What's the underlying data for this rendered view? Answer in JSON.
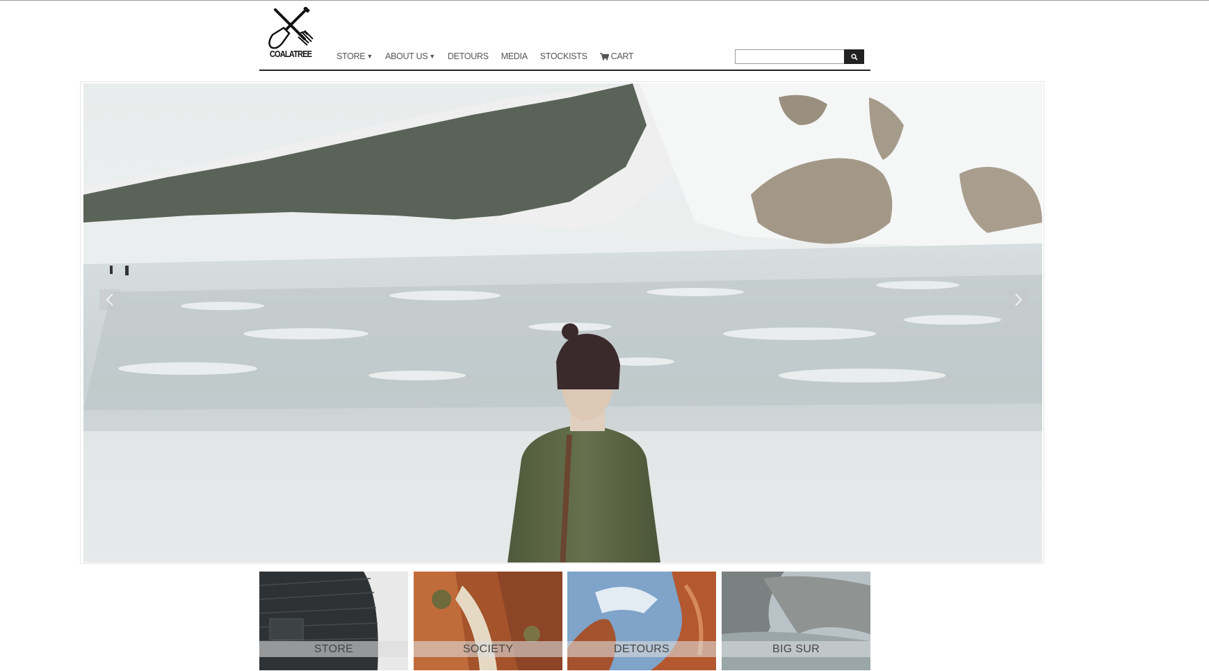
{
  "brand": {
    "logo_text": "COALATREE",
    "logo_icon": "crossed-shovel-fork-icon"
  },
  "nav": {
    "items": [
      {
        "label": "STORE",
        "dropdown": true
      },
      {
        "label": "ABOUT US",
        "dropdown": true
      },
      {
        "label": "DETOURS",
        "dropdown": false
      },
      {
        "label": "MEDIA",
        "dropdown": false
      },
      {
        "label": "STOCKISTS",
        "dropdown": false
      },
      {
        "label": "CART",
        "dropdown": false,
        "icon": "cart-icon"
      }
    ]
  },
  "search": {
    "value": "",
    "button_icon": "search-icon"
  },
  "slider": {
    "prev_icon": "chevron-left-icon",
    "next_icon": "chevron-right-icon"
  },
  "tiles": [
    {
      "label": "STORE"
    },
    {
      "label": "SOCIETY"
    },
    {
      "label": "DETOURS"
    },
    {
      "label": "BIG SUR"
    }
  ],
  "colors": {
    "header_rule": "#222222",
    "nav_text": "#555555",
    "search_button": "#222222"
  }
}
